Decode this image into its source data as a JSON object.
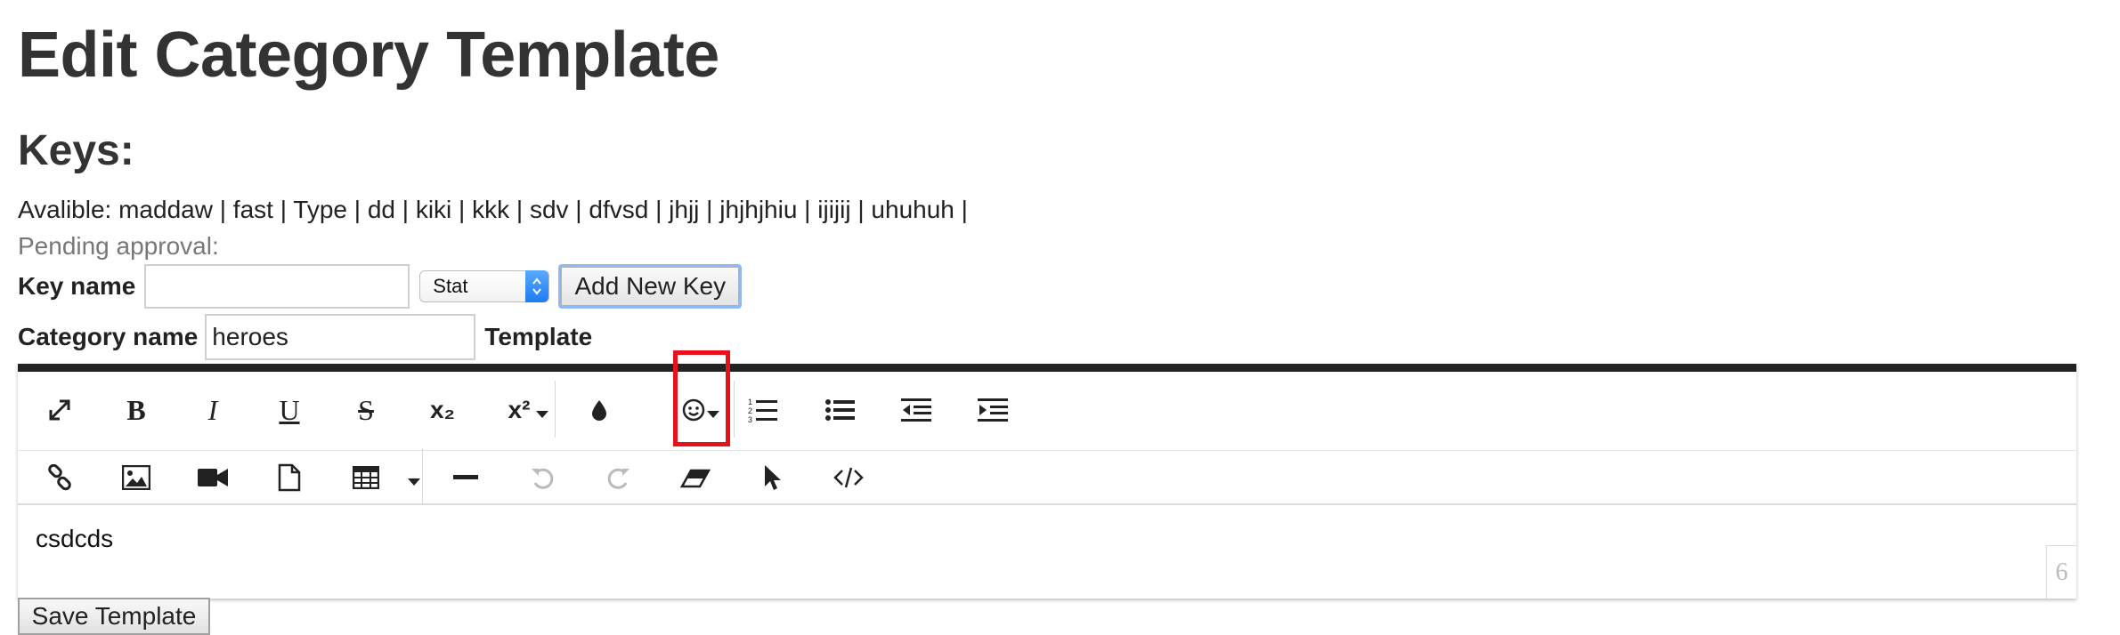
{
  "page": {
    "title": "Edit Category Template",
    "keys_heading": "Keys:"
  },
  "keys": {
    "available_label": "Avalible:",
    "available": [
      "maddaw",
      "fast",
      "Type",
      "dd",
      "kiki",
      "kkk",
      "sdv",
      "dfvsd",
      "jhjj",
      "jhjhjhiu",
      "ijijij",
      "uhuhuh"
    ],
    "pending_label": "Pending approval:"
  },
  "key_form": {
    "key_name_label": "Key name",
    "key_name_value": "",
    "type_select_value": "Stat",
    "add_button_label": "Add New Key"
  },
  "category_form": {
    "category_name_label": "Category name",
    "category_name_value": "heroes",
    "template_label": "Template"
  },
  "editor": {
    "toolbar_row1": [
      "fullscreen",
      "bold",
      "italic",
      "underline",
      "strikethrough",
      "subscript",
      "superscript",
      "color",
      "emoji",
      "ordered-list",
      "unordered-list",
      "outdent",
      "indent"
    ],
    "toolbar_row2": [
      "link",
      "image",
      "video",
      "file",
      "table",
      "horizontal-rule",
      "undo",
      "redo",
      "clear-formatting",
      "select-all",
      "code-view"
    ],
    "labels": {
      "bold": "B",
      "italic": "I",
      "underline": "U",
      "strike": "S",
      "subscript": "x₂",
      "superscript": "x²"
    },
    "content": "csdcds",
    "word_count": "6"
  },
  "save_button_label": "Save Template",
  "colors": {
    "text": "#333333",
    "muted": "#777777",
    "editor_border": "#222222",
    "highlight": "#e8101a",
    "select_accent": "#1e7cf2"
  }
}
